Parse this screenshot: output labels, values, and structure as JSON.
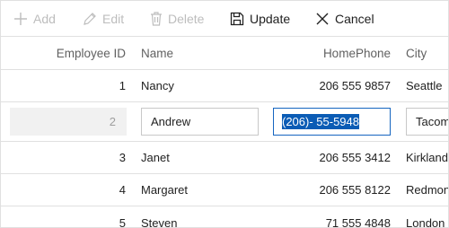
{
  "toolbar": {
    "add_label": "Add",
    "edit_label": "Edit",
    "delete_label": "Delete",
    "update_label": "Update",
    "cancel_label": "Cancel"
  },
  "columns": {
    "employee_id": "Employee ID",
    "name": "Name",
    "home_phone": "HomePhone",
    "city": "City"
  },
  "rows": [
    {
      "id": "1",
      "name": "Nancy",
      "phone": "206 555 9857",
      "city": "Seattle"
    },
    {
      "id": "2",
      "name": "Andrew",
      "phone": "(206)- 55-5948",
      "city": "Tacoma",
      "editing": true
    },
    {
      "id": "3",
      "name": "Janet",
      "phone": "206 555 3412",
      "city": "Kirkland"
    },
    {
      "id": "4",
      "name": "Margaret",
      "phone": "206 555 8122",
      "city": "Redmond"
    },
    {
      "id": "5",
      "name": "Steven",
      "phone": "71 555 4848",
      "city": "London"
    }
  ],
  "colors": {
    "border": "#e0e0e0",
    "focus_border": "#1565c0",
    "selection": "#0b5cb5",
    "disabled": "#bdbdbd"
  }
}
